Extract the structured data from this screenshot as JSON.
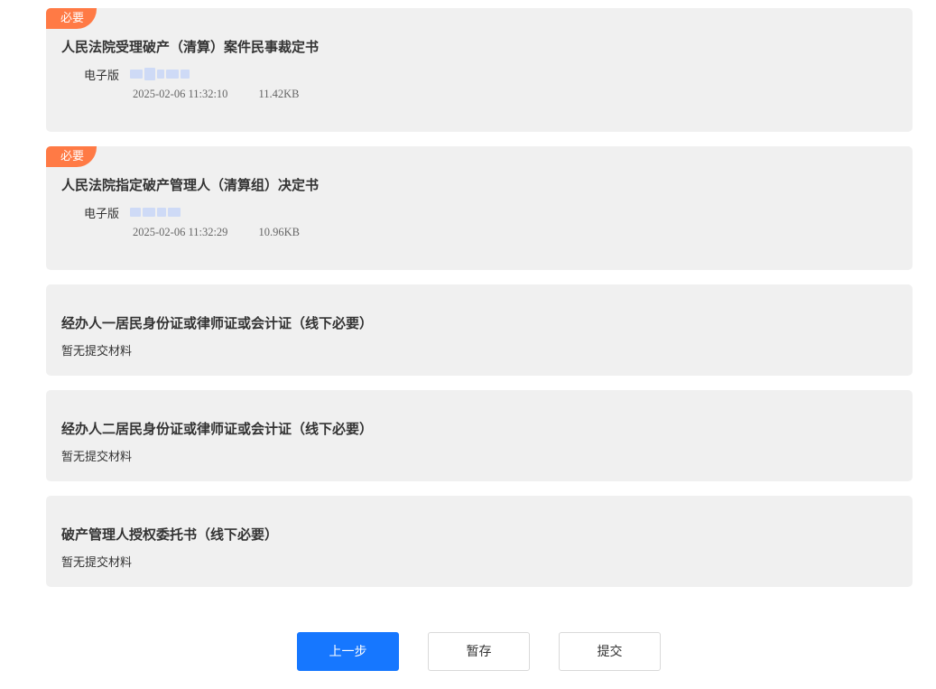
{
  "colors": {
    "accent": "#1677ff",
    "badge": "#ff7a45",
    "card_bg": "#f0f0f0"
  },
  "materials": [
    {
      "required_label": "必要",
      "title": "人民法院受理破产（清算）案件民事裁定书",
      "file_label": "电子版",
      "uploaded_at": "2025-02-06 11:32:10",
      "size": "11.42KB"
    },
    {
      "required_label": "必要",
      "title": "人民法院指定破产管理人（清算组）决定书",
      "file_label": "电子版",
      "uploaded_at": "2025-02-06 11:32:29",
      "size": "10.96KB"
    },
    {
      "title": "经办人一居民身份证或律师证或会计证（线下必要）",
      "empty_text": "暂无提交材料"
    },
    {
      "title": "经办人二居民身份证或律师证或会计证（线下必要）",
      "empty_text": "暂无提交材料"
    },
    {
      "title": "破产管理人授权委托书（线下必要）",
      "empty_text": "暂无提交材料"
    }
  ],
  "actions": {
    "prev_label": "上一步",
    "save_label": "暂存",
    "submit_label": "提交"
  }
}
